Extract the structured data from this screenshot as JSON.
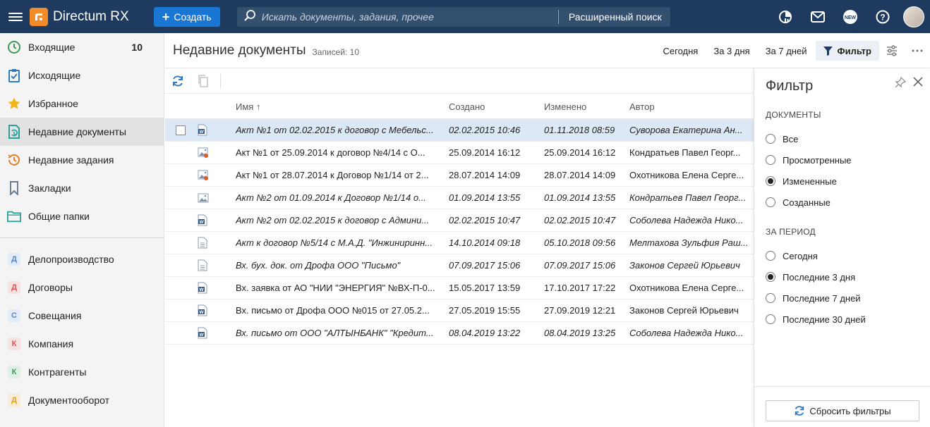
{
  "app": {
    "name": "Directum RX"
  },
  "header": {
    "create_label": "Создать",
    "search_placeholder": "Искать документы, задания, прочее",
    "advanced_search": "Расширенный поиск"
  },
  "sidebar": {
    "items": [
      {
        "label": "Входящие",
        "count": "10",
        "icon": "clock-icon"
      },
      {
        "label": "Исходящие",
        "icon": "clipboard-icon"
      },
      {
        "label": "Избранное",
        "icon": "star-icon"
      },
      {
        "label": "Недавние документы",
        "icon": "recent-doc-icon"
      },
      {
        "label": "Недавние задания",
        "icon": "recent-task-icon"
      },
      {
        "label": "Закладки",
        "icon": "bookmark-icon"
      },
      {
        "label": "Общие папки",
        "icon": "folder-icon"
      }
    ],
    "modules": [
      {
        "letter": "Д",
        "label": "Делопроизводство",
        "color": "#5b87c5",
        "bg": "#e3ebf6"
      },
      {
        "letter": "Д",
        "label": "Договоры",
        "color": "#d55757",
        "bg": "#f7e2e2"
      },
      {
        "letter": "С",
        "label": "Совещания",
        "color": "#5b87c5",
        "bg": "#e3ebf6"
      },
      {
        "letter": "К",
        "label": "Компания",
        "color": "#d55757",
        "bg": "#f7e2e2"
      },
      {
        "letter": "К",
        "label": "Контрагенты",
        "color": "#3f9a5b",
        "bg": "#dff0e4"
      },
      {
        "letter": "Д",
        "label": "Документооборот",
        "color": "#e0a030",
        "bg": "#f8ecd6"
      }
    ]
  },
  "main": {
    "title": "Недавние документы",
    "records": "Записей: 10",
    "periods": [
      "Сегодня",
      "За 3 дня",
      "За 7 дней"
    ],
    "filter_label": "Фильтр",
    "columns": {
      "name": "Имя",
      "sort_arrow": "↑",
      "created": "Создано",
      "modified": "Изменено",
      "author": "Автор"
    },
    "rows": [
      {
        "name": "Акт №1 от 02.02.2015 к договор с Мебельс...",
        "created": "02.02.2015 10:46",
        "modified": "01.11.2018 08:59",
        "author": "Суворова Екатерина Ан...",
        "icon": "word",
        "italic": true,
        "selected": true
      },
      {
        "name": "Акт №1 от 25.09.2014 к договор №4/14 с О...",
        "created": "25.09.2014 16:12",
        "modified": "25.09.2014 16:12",
        "author": "Кондратьев Павел Георг...",
        "icon": "image-red",
        "italic": false
      },
      {
        "name": "Акт №1 от 28.07.2014 к Договор №1/14 от 2...",
        "created": "28.07.2014 14:09",
        "modified": "28.07.2014 14:09",
        "author": "Охотникова Елена Серге...",
        "icon": "image-red",
        "italic": false
      },
      {
        "name": "Акт №2 от 01.09.2014 к Договор №1/14 о...",
        "created": "01.09.2014 13:55",
        "modified": "01.09.2014 13:55",
        "author": "Кондратьев Павел Георг...",
        "icon": "image",
        "italic": true
      },
      {
        "name": "Акт №2 от 02.02.2015 к договор с Админи...",
        "created": "02.02.2015 10:47",
        "modified": "02.02.2015 10:47",
        "author": "Соболева Надежда Нико...",
        "icon": "word",
        "italic": true
      },
      {
        "name": "Акт к договор №5/14 с М.А.Д. \"Инжиниринн...",
        "created": "14.10.2014 09:18",
        "modified": "05.10.2018 09:56",
        "author": "Мелтахова Зульфия Раш...",
        "icon": "doc",
        "italic": true
      },
      {
        "name": "Вх. бух. док. от Дрофа ООО \"Письмо\"",
        "created": "07.09.2017 15:06",
        "modified": "07.09.2017 15:06",
        "author": "Законов Сергей Юрьевич",
        "icon": "doc",
        "italic": true
      },
      {
        "name": "Вх. заявка от АО \"НИИ \"ЭНЕРГИЯ\" №ВХ-П-0...",
        "created": "15.05.2017 13:59",
        "modified": "17.10.2017 17:22",
        "author": "Охотникова Елена Серге...",
        "icon": "word",
        "italic": false
      },
      {
        "name": "Вх. письмо от Дрофа ООО №015 от 27.05.2...",
        "created": "27.05.2019 15:55",
        "modified": "27.09.2019 12:21",
        "author": "Законов Сергей Юрьевич",
        "icon": "word",
        "italic": false
      },
      {
        "name": "Вх. письмо от ООО \"АЛТЫНБАНК\" \"Кредит...",
        "created": "08.04.2019 13:22",
        "modified": "08.04.2019 13:25",
        "author": "Соболева Надежда Нико...",
        "icon": "word",
        "italic": true
      }
    ]
  },
  "filter_panel": {
    "title": "Фильтр",
    "documents_heading": "ДОКУМЕНТЫ",
    "documents_options": [
      {
        "label": "Все",
        "checked": false
      },
      {
        "label": "Просмотренные",
        "checked": false
      },
      {
        "label": "Измененные",
        "checked": true
      },
      {
        "label": "Созданные",
        "checked": false
      }
    ],
    "period_heading": "ЗА ПЕРИОД",
    "period_options": [
      {
        "label": "Сегодня",
        "checked": false
      },
      {
        "label": "Последние 3 дня",
        "checked": true
      },
      {
        "label": "Последние 7 дней",
        "checked": false
      },
      {
        "label": "Последние 30 дней",
        "checked": false
      }
    ],
    "reset_label": "Сбросить фильтры"
  },
  "colors": {
    "topbar": "#1e3a5f",
    "accent": "#1976d2",
    "logo": "#f28c28",
    "selected_row": "#dce8f5"
  }
}
